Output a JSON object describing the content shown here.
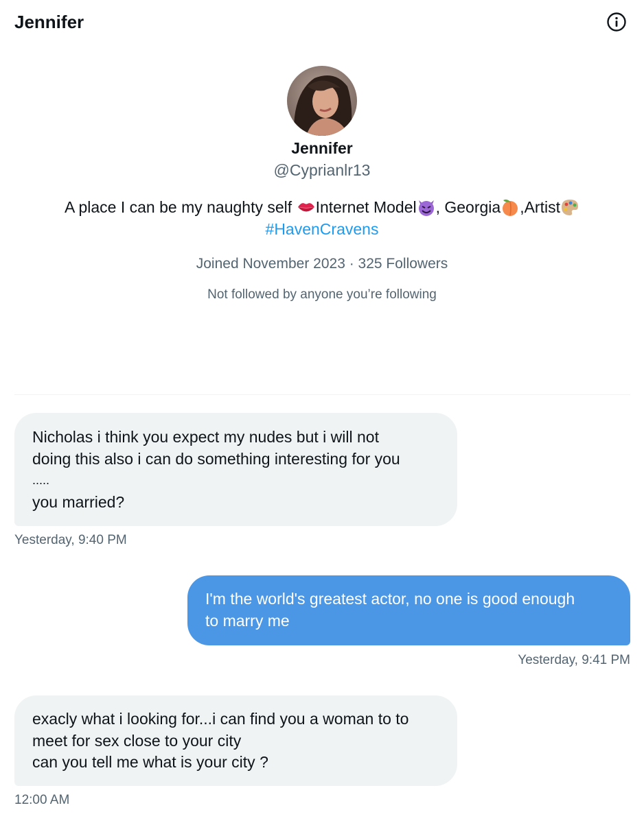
{
  "header": {
    "title": "Jennifer",
    "info_icon": "info-circle-icon"
  },
  "profile": {
    "avatar_icon": "avatar-photo",
    "name": "Jennifer",
    "handle": "@Cyprianlr13",
    "bio": {
      "part1": "A place I can be my naughty self ",
      "part2": "Internet Model",
      "part3": ", Georgia",
      "part4": ",Artist",
      "emojis": [
        "lips-emoji",
        "smiling-devil-emoji",
        "peach-emoji",
        "artist-palette-emoji"
      ],
      "hashtag": "#HavenCravens"
    },
    "meta": "Joined November 2023 · 325 Followers",
    "follow_note": "Not followed by anyone you’re following"
  },
  "messages": [
    {
      "direction": "incoming",
      "lines": [
        "Nicholas i think you expect my nudes but i will not",
        "doing this also i can do something interesting for you",
        ".....",
        "you married?"
      ],
      "timestamp": "Yesterday, 9:40 PM"
    },
    {
      "direction": "outgoing",
      "lines": [
        "I'm the world's greatest actor, no one is good enough",
        "to marry me"
      ],
      "timestamp": "Yesterday, 9:41 PM"
    },
    {
      "direction": "incoming",
      "lines": [
        "exacly what i looking for...i can find you a woman to to",
        "meet for sex close to your city",
        "can you tell me what is your city ?"
      ],
      "timestamp": "12:00 AM"
    }
  ],
  "colors": {
    "accent": "#1d9bf0",
    "outgoing_bubble": "#4b97e5",
    "incoming_bubble": "#eff3f4",
    "secondary_text": "#536471"
  }
}
